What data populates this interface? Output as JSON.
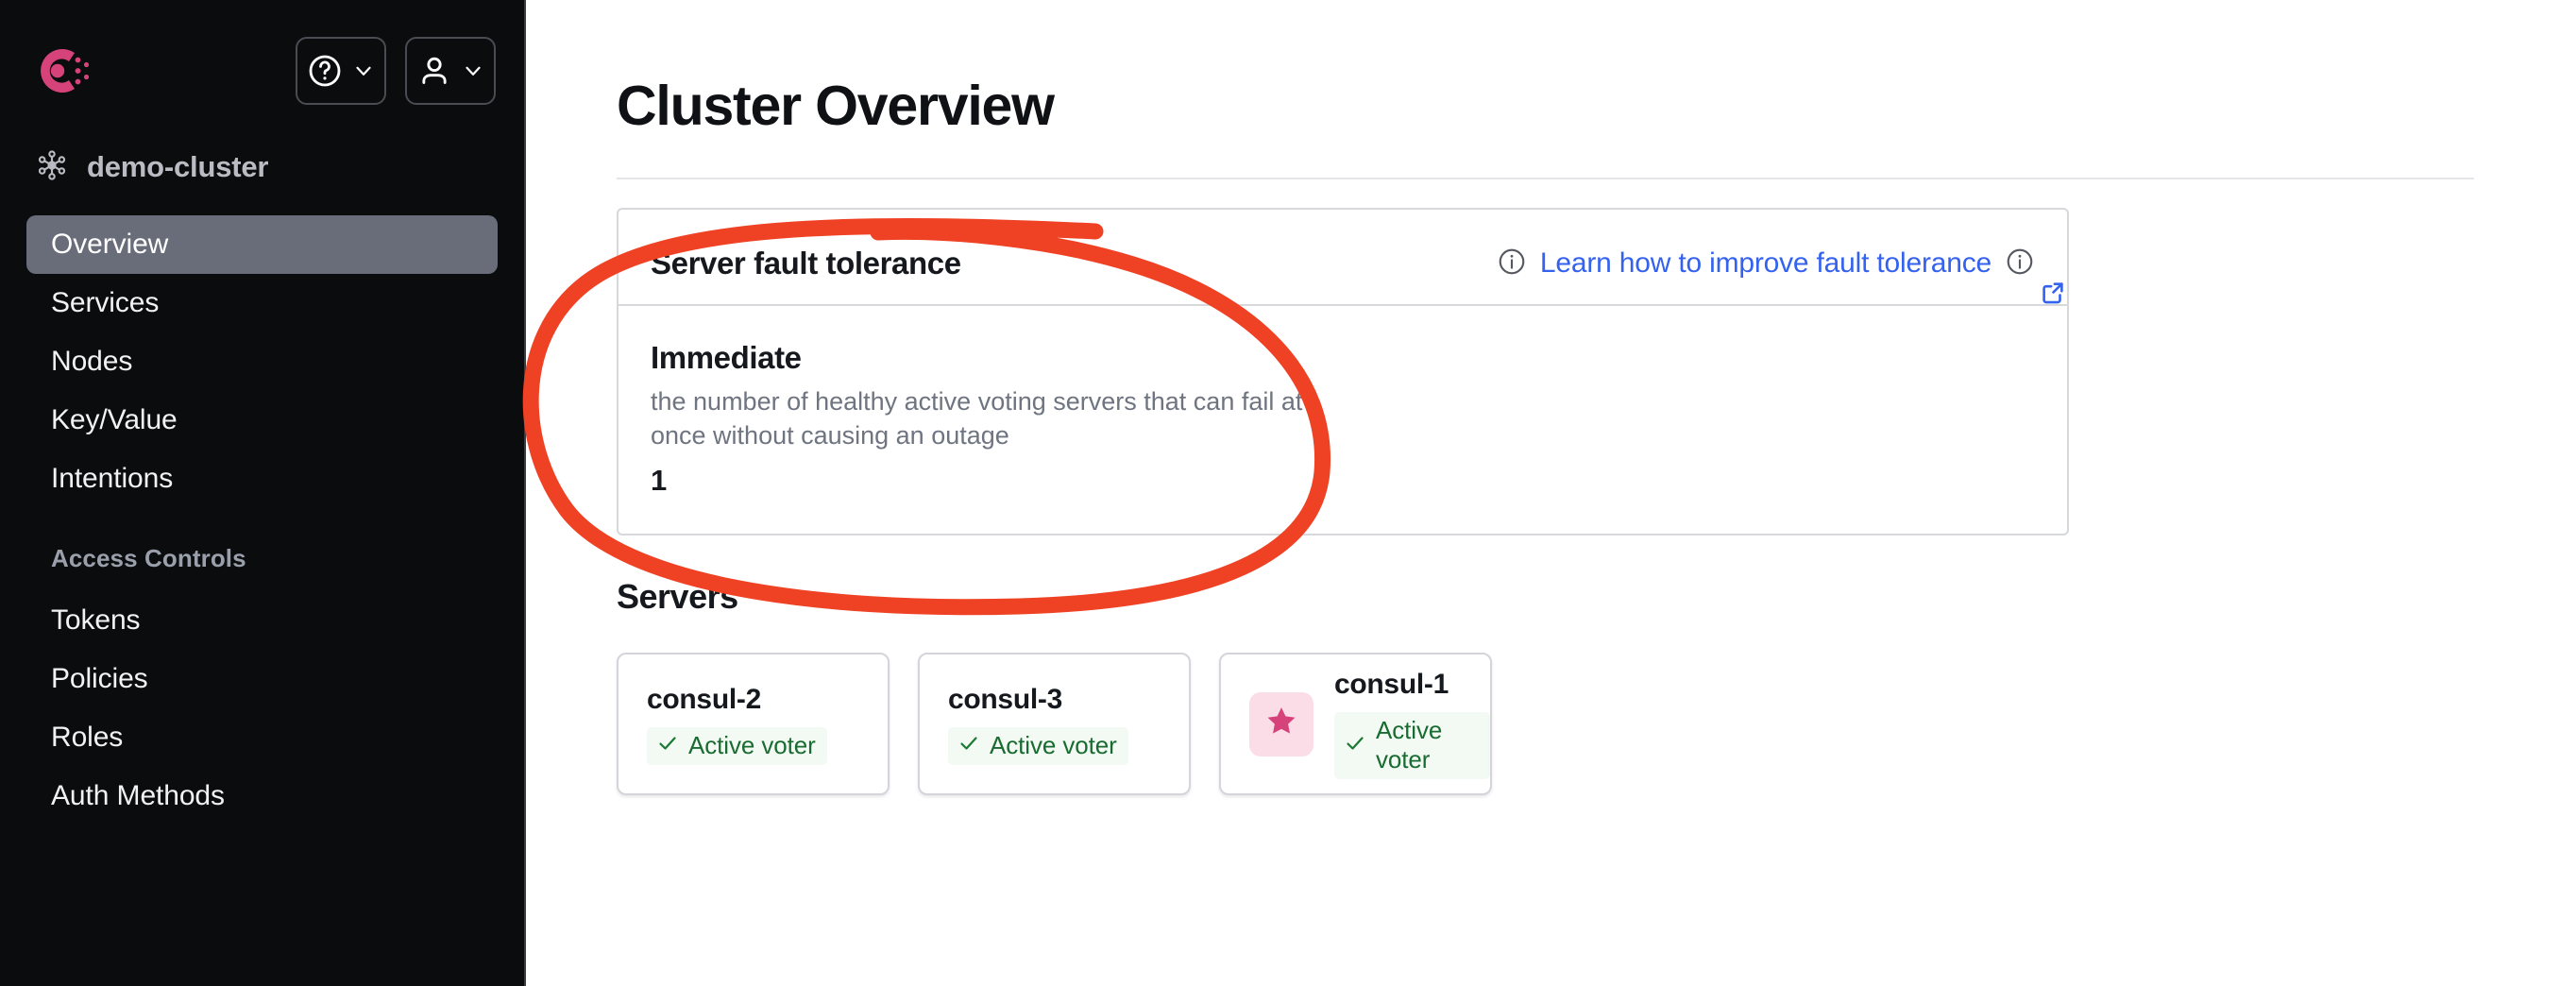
{
  "sidebar": {
    "logo_icon": "consul-logo-icon",
    "help_button": {
      "icon": "question-circle-icon",
      "chevron": "chevron-down-icon"
    },
    "user_button": {
      "icon": "user-icon",
      "chevron": "chevron-down-icon"
    },
    "cluster": {
      "icon": "cluster-network-icon",
      "name": "demo-cluster"
    },
    "nav_items": [
      {
        "label": "Overview",
        "active": true
      },
      {
        "label": "Services",
        "active": false
      },
      {
        "label": "Nodes",
        "active": false
      },
      {
        "label": "Key/Value",
        "active": false
      },
      {
        "label": "Intentions",
        "active": false
      }
    ],
    "section_title": "Access Controls",
    "access_items": [
      {
        "label": "Tokens"
      },
      {
        "label": "Policies"
      },
      {
        "label": "Roles"
      },
      {
        "label": "Auth Methods"
      }
    ]
  },
  "main": {
    "page_title": "Cluster Overview",
    "fault_tolerance": {
      "title": "Server fault tolerance",
      "info_icon_left": "info-circle-icon",
      "link_text": "Learn how to improve fault tolerance",
      "info_icon_right": "info-circle-icon",
      "external_link_icon": "external-link-icon",
      "metric_label": "Immediate",
      "metric_description": "the number of healthy active voting servers that can fail at once without causing an outage",
      "metric_value": "1"
    },
    "servers_heading": "Servers",
    "servers": [
      {
        "name": "consul-2",
        "status": "Active voter",
        "status_icon": "check-icon",
        "leader": false
      },
      {
        "name": "consul-3",
        "status": "Active voter",
        "status_icon": "check-icon",
        "leader": false
      },
      {
        "name": "consul-1",
        "status": "Active voter",
        "status_icon": "check-icon",
        "leader": true,
        "leader_icon": "star-icon"
      }
    ]
  },
  "annotation": {
    "shape": "ellipse-highlight",
    "color": "#ef4123"
  },
  "colors": {
    "sidebar_bg": "#0b0c0e",
    "nav_active_bg": "#686d79",
    "link_blue": "#3462ee",
    "brand_pink": "#d6437b",
    "status_green": "#1a6b31",
    "annotation_red": "#ef4123"
  }
}
